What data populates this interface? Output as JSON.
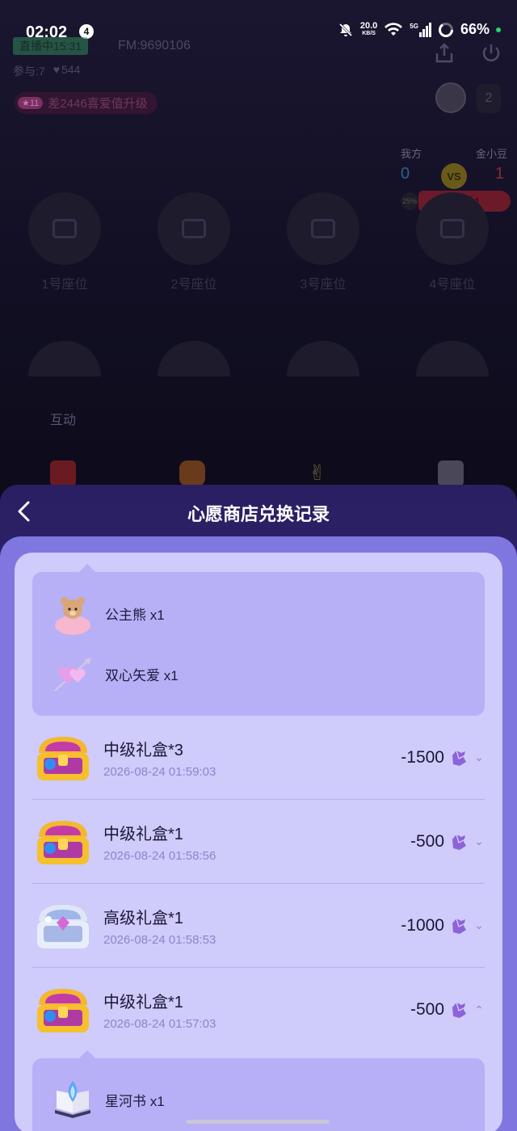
{
  "status_bar": {
    "time": "02:02",
    "notification_count": "4",
    "net_speed_value": "20.0",
    "net_speed_unit": "KB/S",
    "network_type": "5G",
    "battery": "66%",
    "icons": [
      "mute-bell-icon",
      "wifi-icon",
      "signal-icon",
      "battery-ring-icon"
    ]
  },
  "room": {
    "live_tag": "直播中15:31",
    "fm_id": "FM:9690106",
    "participants": "参与:7",
    "likes": "544",
    "level_badge": "11",
    "level_text": "差2446喜爱值升级",
    "viewer_count": "2",
    "pk": {
      "ours_label": "我方",
      "theirs_label": "金小豆",
      "ours_score": "0",
      "theirs_score": "1",
      "vs": "VS",
      "status": "落后1",
      "small_badge": "25%"
    },
    "seats": [
      "1号座位",
      "2号座位",
      "3号座位",
      "4号座位"
    ],
    "interact_label": "互动",
    "interact_icons": [
      "red-envelope-icon",
      "lantern-icon",
      "hand-gesture-icon",
      "dice-icon"
    ]
  },
  "sheet": {
    "title": "心愿商店兑换记录",
    "back_icon": "chevron-left-icon",
    "top_detail": [
      {
        "label": "公主熊 x1",
        "icon": "princess-bear-icon"
      },
      {
        "label": "双心矢爱 x1",
        "icon": "double-heart-arrow-icon"
      }
    ],
    "records": [
      {
        "name": "中级礼盒*3",
        "time": "2026-08-24 01:59:03",
        "cost": "-1500",
        "icon": "gold-chest-icon",
        "expanded": false
      },
      {
        "name": "中级礼盒*1",
        "time": "2026-08-24 01:58:56",
        "cost": "-500",
        "icon": "gold-chest-icon",
        "expanded": false
      },
      {
        "name": "高级礼盒*1",
        "time": "2026-08-24 01:58:53",
        "cost": "-1000",
        "icon": "silver-chest-icon",
        "expanded": false
      },
      {
        "name": "中级礼盒*1",
        "time": "2026-08-24 01:57:03",
        "cost": "-500",
        "icon": "gold-chest-icon",
        "expanded": true
      }
    ],
    "bottom_detail": [
      {
        "label": "星河书 x1",
        "icon": "star-book-icon"
      }
    ],
    "colors": {
      "sheet_bg": "#2a1f62",
      "body_bg": "#7f76e0",
      "card_bg": "#cfcbfb",
      "detail_bg": "#b7b0f6"
    }
  }
}
